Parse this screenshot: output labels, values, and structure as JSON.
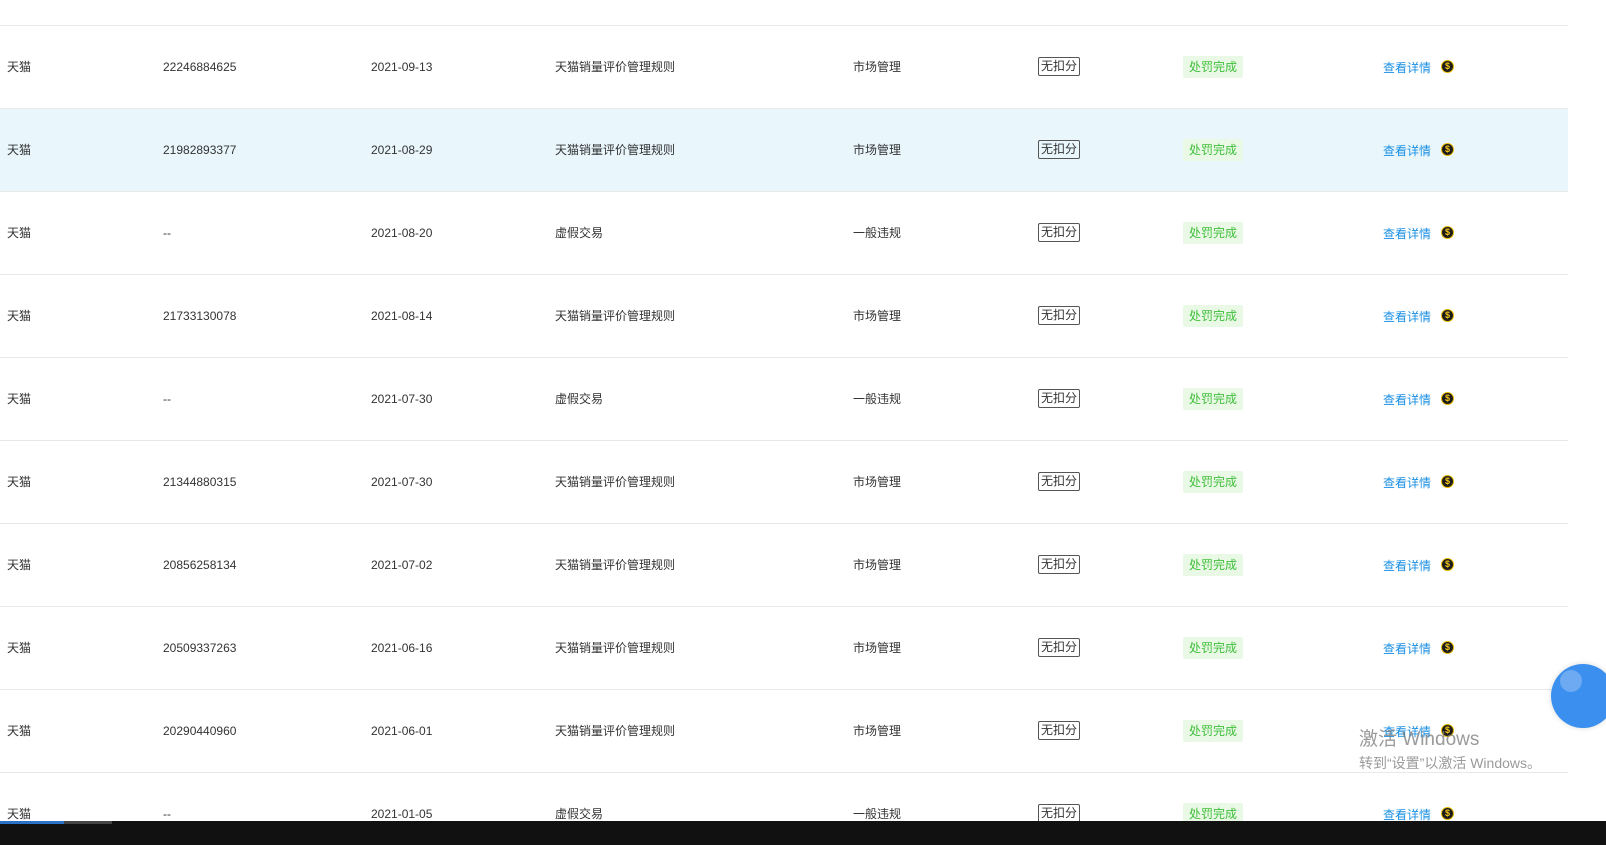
{
  "table": {
    "rows": [
      {
        "platform": "天猫",
        "id": "22246884625",
        "date": "2021-09-13",
        "rule": "天猫销量评价管理规则",
        "type": "市场管理",
        "score": "无扣分",
        "status": "处罚完成",
        "action": "查看详情"
      },
      {
        "platform": "天猫",
        "id": "21982893377",
        "date": "2021-08-29",
        "rule": "天猫销量评价管理规则",
        "type": "市场管理",
        "score": "无扣分",
        "status": "处罚完成",
        "action": "查看详情"
      },
      {
        "platform": "天猫",
        "id": "--",
        "date": "2021-08-20",
        "rule": "虚假交易",
        "type": "一般违规",
        "score": "无扣分",
        "status": "处罚完成",
        "action": "查看详情"
      },
      {
        "platform": "天猫",
        "id": "21733130078",
        "date": "2021-08-14",
        "rule": "天猫销量评价管理规则",
        "type": "市场管理",
        "score": "无扣分",
        "status": "处罚完成",
        "action": "查看详情"
      },
      {
        "platform": "天猫",
        "id": "--",
        "date": "2021-07-30",
        "rule": "虚假交易",
        "type": "一般违规",
        "score": "无扣分",
        "status": "处罚完成",
        "action": "查看详情"
      },
      {
        "platform": "天猫",
        "id": "21344880315",
        "date": "2021-07-30",
        "rule": "天猫销量评价管理规则",
        "type": "市场管理",
        "score": "无扣分",
        "status": "处罚完成",
        "action": "查看详情"
      },
      {
        "platform": "天猫",
        "id": "20856258134",
        "date": "2021-07-02",
        "rule": "天猫销量评价管理规则",
        "type": "市场管理",
        "score": "无扣分",
        "status": "处罚完成",
        "action": "查看详情"
      },
      {
        "platform": "天猫",
        "id": "20509337263",
        "date": "2021-06-16",
        "rule": "天猫销量评价管理规则",
        "type": "市场管理",
        "score": "无扣分",
        "status": "处罚完成",
        "action": "查看详情"
      },
      {
        "platform": "天猫",
        "id": "20290440960",
        "date": "2021-06-01",
        "rule": "天猫销量评价管理规则",
        "type": "市场管理",
        "score": "无扣分",
        "status": "处罚完成",
        "action": "查看详情"
      },
      {
        "platform": "天猫",
        "id": "--",
        "date": "2021-01-05",
        "rule": "虚假交易",
        "type": "一般违规",
        "score": "无扣分",
        "status": "处罚完成",
        "action": "查看详情"
      }
    ]
  },
  "watermark": {
    "title": "激活 Windows",
    "subtitle": "转到“设置”以激活 Windows。"
  },
  "icons": {
    "row_action": "coin-icon",
    "floating": "floating-service-button"
  },
  "colors": {
    "link": "#1a8fe3",
    "status_text": "#3fbf3a",
    "status_bg": "#e9f9e6",
    "row_highlight": "#e9f7fd",
    "floating_button": "#3b8fee"
  }
}
